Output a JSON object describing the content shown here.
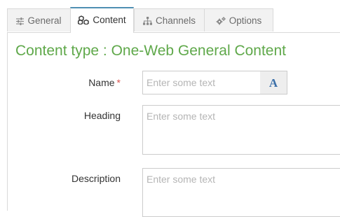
{
  "tabs": [
    {
      "label": "General",
      "icon": "sliders-icon",
      "active": false
    },
    {
      "label": "Content",
      "icon": "cubes-icon",
      "active": true
    },
    {
      "label": "Channels",
      "icon": "sitemap-icon",
      "active": false
    },
    {
      "label": "Options",
      "icon": "cogs-icon",
      "active": false
    }
  ],
  "content_type_title": "Content type : One-Web General Content",
  "form": {
    "name": {
      "label": "Name",
      "required_mark": "*",
      "placeholder": "Enter some text",
      "value": ""
    },
    "name_addon": {
      "label": "A",
      "icon": "font-letter-icon"
    },
    "heading": {
      "label": "Heading",
      "placeholder": "Enter some text",
      "value": ""
    },
    "description": {
      "label": "Description",
      "placeholder": "Enter some text",
      "value": ""
    }
  },
  "colors": {
    "title_green": "#5fa84a",
    "active_tab_border": "#4f8fb3",
    "required_red": "#d9534f",
    "addon_blue": "#3b6fa8"
  }
}
